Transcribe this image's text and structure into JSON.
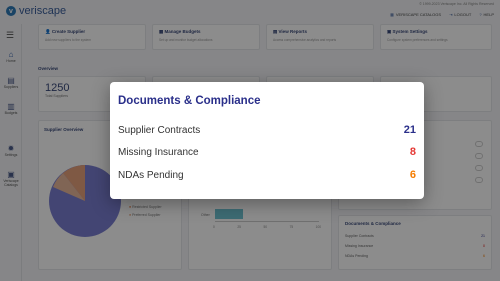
{
  "app": {
    "brand": "veriscape",
    "copyright": "© 1999-2023 Veriscape Inc. All Rights Reserved",
    "top_links": [
      {
        "icon": "grid-icon",
        "label": "VERISCAPE CATALOGS"
      },
      {
        "icon": "logout-icon",
        "label": "LOGOUT"
      },
      {
        "icon": "help-icon",
        "label": "HELP"
      }
    ]
  },
  "sidebar": {
    "items": [
      {
        "icon": "home-icon",
        "label": "Home"
      },
      {
        "icon": "suppliers-icon",
        "label": "Suppliers"
      },
      {
        "icon": "budgets-icon",
        "label": "Budgets"
      },
      {
        "icon": "settings-icon",
        "label": "Settings"
      },
      {
        "icon": "veriscape-catalogs-icon",
        "label": "Veriscape Catalogs"
      }
    ]
  },
  "quick_actions": [
    {
      "title": "Create Supplier",
      "subtitle": "Add new suppliers to the system"
    },
    {
      "title": "Manage Budgets",
      "subtitle": "Set up and monitor budget allocations"
    },
    {
      "title": "View Reports",
      "subtitle": "Access comprehensive analytics and reports"
    },
    {
      "title": "System Settings",
      "subtitle": "Configure system preferences and settings"
    }
  ],
  "overview": {
    "label": "Overview",
    "total_suppliers_value": "1250",
    "total_suppliers_label": "Total Suppliers",
    "supplier_overview_label": "Supplier Overview",
    "legend": [
      "Restricted Supplier",
      "Preferred Supplier"
    ],
    "bar_tick_labels": [
      "0",
      "25",
      "50",
      "75",
      "100"
    ],
    "bar_category": "Other"
  },
  "compliance_small": {
    "title": "Documents & Compliance",
    "rows": [
      {
        "label": "Supplier Contracts",
        "value": "21"
      },
      {
        "label": "Missing Insurance",
        "value": "8"
      },
      {
        "label": "NDAs Pending",
        "value": "6"
      }
    ]
  },
  "modal": {
    "title": "Documents & Compliance",
    "rows": [
      {
        "label": "Supplier Contracts",
        "value": "21",
        "color": "#2a2f8a"
      },
      {
        "label": "Missing Insurance",
        "value": "8",
        "color": "#e53935"
      },
      {
        "label": "NDAs Pending",
        "value": "6",
        "color": "#f57c00"
      }
    ]
  }
}
